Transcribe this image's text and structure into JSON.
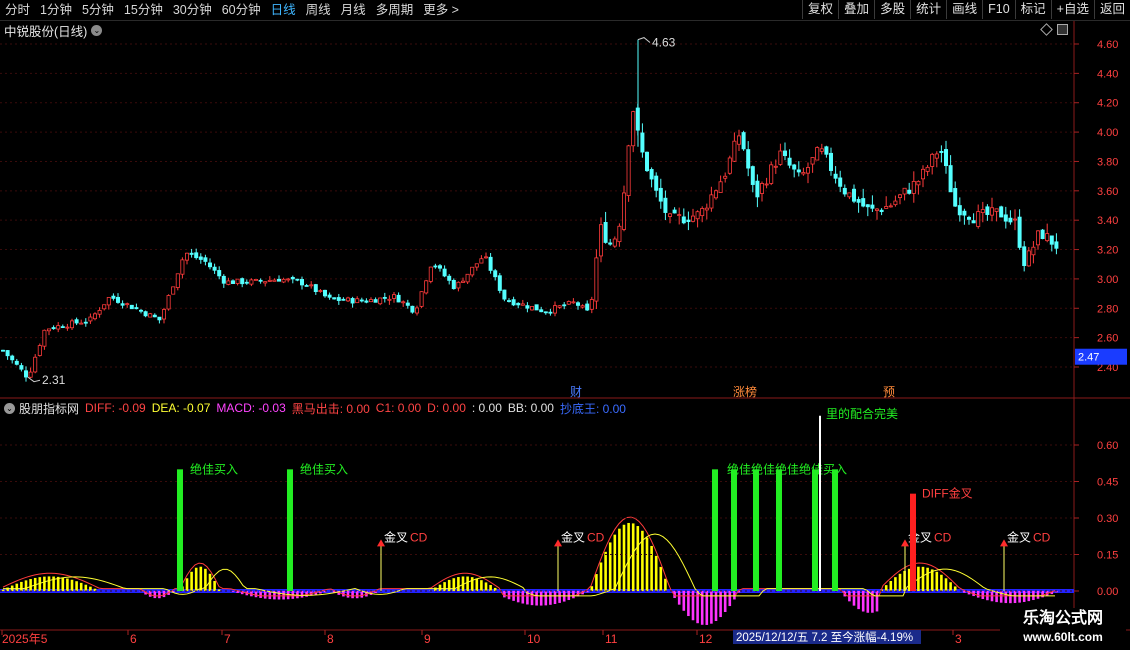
{
  "toolbar": {
    "periods": [
      "分时",
      "1分钟",
      "5分钟",
      "15分钟",
      "30分钟",
      "60分钟",
      "日线",
      "周线",
      "月线",
      "多周期",
      "更多 >"
    ],
    "active_period": "日线",
    "buttons": [
      "复权",
      "叠加",
      "多股",
      "统计",
      "画线",
      "F10",
      "标记",
      "+自选",
      "返回"
    ]
  },
  "stock": {
    "title": "中锐股份(日线)"
  },
  "price_axis": {
    "ticks": [
      "4.60",
      "4.40",
      "4.20",
      "4.00",
      "3.80",
      "3.60",
      "3.40",
      "3.20",
      "3.00",
      "2.80",
      "2.60",
      "2.40"
    ],
    "current_price": "2.47",
    "high_label": "4.63",
    "low_label": "2.31"
  },
  "event_tags": [
    "财",
    "涨榜",
    "预"
  ],
  "indicator": {
    "name": "股朋指标网",
    "diff": "DIFF: -0.09",
    "dea": "DEA: -0.07",
    "macd": "MACD: -0.03",
    "hm": "黑马出击: 0.00",
    "c1": "C1: 0.00",
    "d": "D: 0.00",
    "colon": ": 0.00",
    "bb": "BB: 0.00",
    "cdw": "抄底王: 0.00",
    "axis_ticks": [
      "0.60",
      "0.45",
      "0.30",
      "0.15",
      "0.00"
    ],
    "signals": {
      "buy": "绝佳买入",
      "buy_overlap": "绝佳绝佳绝佳绝佳买入",
      "golden_cross": "金叉",
      "cd_suffix": "CD",
      "diff_golden": "DIFF金叉",
      "top_cut": "里的配合完美"
    }
  },
  "time_axis": {
    "labels": [
      "2025年5",
      "6",
      "7",
      "8",
      "9",
      "10",
      "11",
      "12",
      "3"
    ],
    "info_box": "2025/12/12/五 7.2 至今涨幅-4.19%"
  },
  "watermark": {
    "line1": "乐淘公式网",
    "line2": "www.60lt.com"
  },
  "colors": {
    "up": "#ff3b3b",
    "down": "#54ffff",
    "buy": "#22ee22",
    "dea": "#ffff00",
    "macd_pos": "#ffff00",
    "macd_neg": "#ff33ff",
    "zero_line": "#2222ff"
  }
}
